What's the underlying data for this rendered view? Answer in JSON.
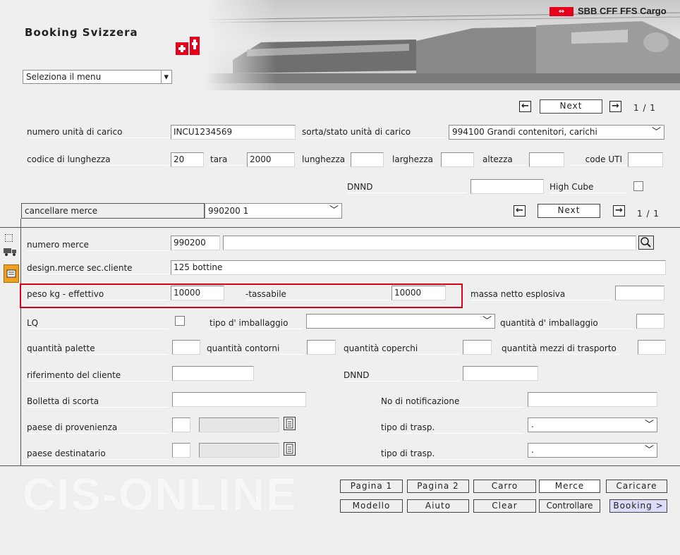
{
  "header": {
    "title": "Booking Svizzera",
    "brand": "SBB CFF FFS Cargo",
    "menu_select": "Seleziona il menu"
  },
  "pager_top": {
    "next_label": "Next",
    "count": "1 / 1"
  },
  "pager_goods": {
    "next_label": "Next",
    "count": "1 / 1"
  },
  "unit": {
    "numero_label": "numero unità di carico",
    "numero_value": "INCU1234569",
    "sorta_label": "sorta/stato unità di carico",
    "sorta_value": "994100  Grandi contenitori, carichi",
    "codice_label": "codice di lunghezza",
    "codice_value": "20",
    "tara_label": "tara",
    "tara_value": "2000",
    "lunghezza_label": "lunghezza",
    "larghezza_label": "larghezza",
    "altezza_label": "altezza",
    "code_uti_label": "code UTI",
    "dnnd_label": "DNND",
    "high_cube_label": "High Cube"
  },
  "goods_bar": {
    "cancel_label": "cancellare merce",
    "select_value": "990200  1"
  },
  "goods": {
    "numero_merce_label": "numero merce",
    "numero_merce_value": "990200",
    "design_label": "design.merce sec.cliente",
    "design_value": "125 bottine",
    "peso_label": "peso kg - effettivo",
    "peso_value": "10000",
    "tassabile_label": "-tassabile",
    "tassabile_value": "10000",
    "massa_label": "massa netto esplosiva",
    "lq_label": "LQ",
    "tipo_imb_label": "tipo d' imballaggio",
    "quant_imb_label": "quantità d' imballaggio",
    "palette_label": "quantità palette",
    "contorni_label": "quantità contorni",
    "coperchi_label": "quantità coperchi",
    "mezzi_label": "quantità mezzi di trasporto",
    "riferimento_label": "riferimento del cliente",
    "dnnd_label": "DNND",
    "bolletta_label": "Bolletta di scorta",
    "notifica_label": "No di notificazione",
    "provenienza_label": "paese di provenienza",
    "destinatario_label": "paese destinatario",
    "trasp_label_1": "tipo di trasp.",
    "trasp_value_1": ".",
    "trasp_label_2": "tipo di trasp.",
    "trasp_value_2": "."
  },
  "footer": {
    "logo_text": "CIS-ONLINE",
    "buttons_row1": [
      "Pagina 1",
      "Pagina 2",
      "Carro",
      "Merce",
      "Caricare"
    ],
    "buttons_row2": [
      "Modello",
      "Aiuto",
      "Clear",
      "Controllare",
      "Booking >"
    ]
  },
  "colors": {
    "highlight": "#d9001b",
    "brand_red": "#e4001b",
    "booking_button": "#dcdcf8"
  }
}
